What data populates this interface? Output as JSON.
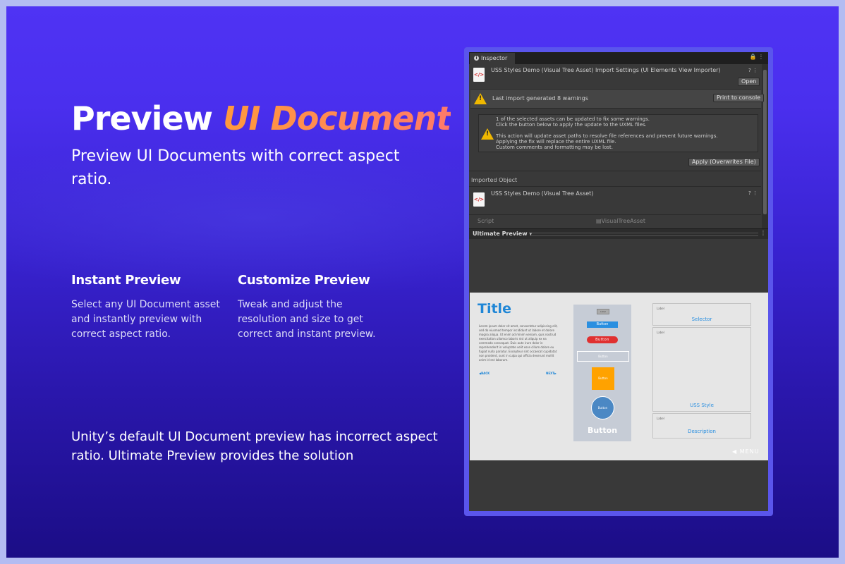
{
  "hero": {
    "title_main": "Preview",
    "title_accent": "UI Document",
    "subtitle": "Preview UI Documents with correct aspect ratio."
  },
  "features": [
    {
      "title": "Instant Preview",
      "text": "Select any UI Document asset and instantly preview with correct aspect ratio."
    },
    {
      "title": "Customize Preview",
      "text": "Tweak and adjust the resolution and size to get correct and instant preview."
    }
  ],
  "bottom_note": "Unity’s default UI Document preview has incorrect aspect ratio. Ultimate Preview provides the solution",
  "inspector": {
    "tab_label": "Inspector",
    "tab_icons": "🔒 ⋮",
    "asset_icon": "</>",
    "import_title": "USS Styles Demo (Visual Tree Asset) Import Settings (UI Elements View Importer)",
    "header_icons": "? ⋮",
    "open_button": "Open",
    "warning_summary": "Last import generated 8 warnings",
    "print_button": "Print to console",
    "update_lines": [
      "1 of the selected assets can be updated to fix some warnings.",
      "Click the button below to apply the update to the UXML files.",
      "",
      "This action will update asset paths to resolve file references and prevent future warnings.",
      "Applying the fix will replace the entire UXML file.",
      "Custom comments and formatting may be lost."
    ],
    "apply_button": "Apply (Overwrites File)",
    "imported_object_label": "Imported Object",
    "imported_object_title": "USS Styles Demo (Visual Tree Asset)",
    "script_label": "Script",
    "script_value": "VisualTreeAsset",
    "preview_label": "Ultimate Preview ▾"
  },
  "preview_doc": {
    "title": "Title",
    "lorem": "Lorem ipsum dolor sit amet, consectetur adipiscing elit, sed do eiusmod tempor incididunt ut labore et dolore magna aliqua. Ut enim ad minim veniam, quis nostrud exercitation ullamco laboris nisi ut aliquip ex ea commodo consequat. Duis aute irure dolor in reprehenderit in voluptate velit esse cillum dolore eu fugiat nulla pariatur. Excepteur sint occaecat cupidatat non proident, sunt in culpa qui officia deserunt mollit anim id est laborum.",
    "back": "◀BACK",
    "next": "NEXT▶",
    "mini_label": "Label",
    "button_blue": "Button",
    "button_red": "Button",
    "button_outline": "Button",
    "button_orange": "Button",
    "button_circle": "Button",
    "button_big": "Button",
    "panels": [
      {
        "label": "Label",
        "value": "Selector"
      },
      {
        "label": "Label",
        "value": "USS Style"
      },
      {
        "label": "Label",
        "value": "Description"
      }
    ],
    "menu": "◀ MENU"
  }
}
